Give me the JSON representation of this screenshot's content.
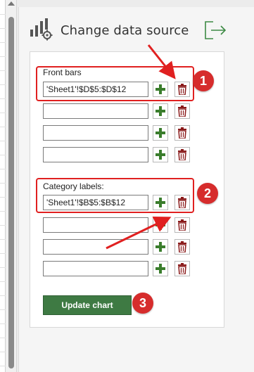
{
  "panel": {
    "title": "Change data source",
    "icon": "chart-settings-icon",
    "exit_icon": "exit-icon"
  },
  "front_bars": {
    "label": "Front bars",
    "fields": [
      "'Sheet1'!$D$5:$D$12",
      "",
      "",
      ""
    ]
  },
  "category_labels": {
    "label": "Category labels:",
    "fields": [
      "'Sheet1'!$B$5:$B$12",
      "",
      "",
      ""
    ]
  },
  "update_button": {
    "label": "Update chart"
  },
  "annotations": {
    "badges": [
      "1",
      "2",
      "3"
    ],
    "color": "#e02020"
  },
  "colors": {
    "accent_green": "#3e7a43",
    "plus_green": "#3a7d2c",
    "trash_red": "#8a1a1a"
  }
}
